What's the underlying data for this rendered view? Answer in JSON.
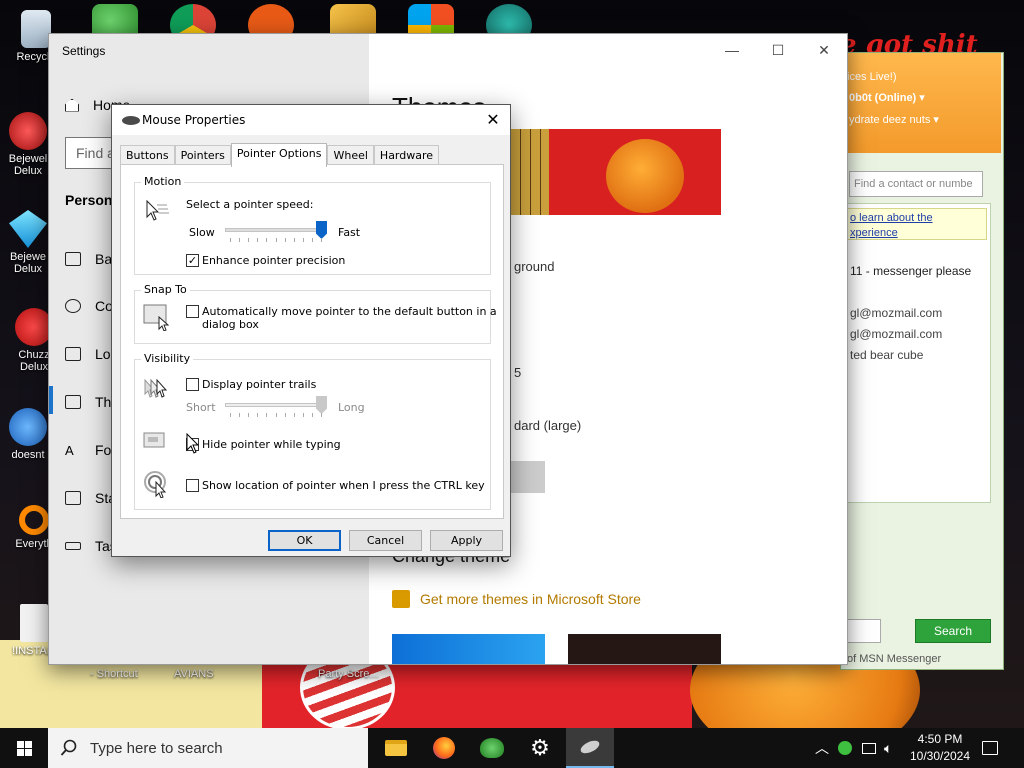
{
  "desktop": {
    "icons": [
      {
        "label": "Recycle",
        "name": "recycle-bin"
      },
      {
        "label": "Bejewel\nDelux",
        "name": "bejeweled-1"
      },
      {
        "label": "Bejewe\nDelux",
        "name": "bejeweled-2"
      },
      {
        "label": "Chuzz\nDelux",
        "name": "chuzzle"
      },
      {
        "label": "doesnt",
        "name": "doesnt"
      },
      {
        "label": "Everyth",
        "name": "everything"
      },
      {
        "label": "!INSTALI",
        "name": "install"
      }
    ],
    "shortcut_labels": [
      "- Shortcut",
      "AVIANS",
      "Party Scre..."
    ],
    "wallpaper_text": "e got shit"
  },
  "settings": {
    "title": "Settings",
    "controls": {
      "minimize": "—",
      "maximize": "☐",
      "close": "✕"
    },
    "home": "Home",
    "find_placeholder": "Find a",
    "section": "Personal",
    "nav": [
      {
        "label": "Ba",
        "name": "nav-background"
      },
      {
        "label": "Co",
        "name": "nav-colors"
      },
      {
        "label": "Lo",
        "name": "nav-lock-screen"
      },
      {
        "label": "Th",
        "name": "nav-themes"
      },
      {
        "label": "Fo",
        "name": "nav-fonts"
      },
      {
        "label": "Sta",
        "name": "nav-start"
      },
      {
        "label": "Tas",
        "name": "nav-taskbar"
      }
    ],
    "page_title": "Themes",
    "lines": [
      "ground",
      "5",
      "dard (large)"
    ],
    "change_theme": "Change theme",
    "store_link": "Get more themes in Microsoft Store"
  },
  "messenger": {
    "header": [
      "ices Live!)",
      "0b0t  (Online) ▾",
      "ydrate deez nuts ▾"
    ],
    "find_placeholder": "Find a contact or numbe",
    "note": [
      "o learn about the",
      "xperience"
    ],
    "items": [
      "11 - messenger please",
      "gl@mozmail.com",
      "gl@mozmail.com",
      "ted bear cube"
    ],
    "search_button": "Search",
    "footer": "of MSN Messenger"
  },
  "dialog": {
    "title": "Mouse Properties",
    "close": "✕",
    "tabs": [
      "Buttons",
      "Pointers",
      "Pointer Options",
      "Wheel",
      "Hardware"
    ],
    "active_tab": 2,
    "motion": {
      "label": "Motion",
      "speed_label": "Select a pointer speed:",
      "slow": "Slow",
      "fast": "Fast",
      "speed_value": 1.0,
      "enhance_label": "Enhance pointer precision",
      "enhance_checked": true
    },
    "snap": {
      "label": "Snap To",
      "text_1": "Automatically move pointer to the default button in a",
      "text_2": "dialog box",
      "checked": false
    },
    "visibility": {
      "label": "Visibility",
      "trails_label": "Display pointer trails",
      "trails_checked": false,
      "short": "Short",
      "long": "Long",
      "trail_value": 1.0,
      "hide_label": "Hide pointer while typing",
      "hide_checked": false,
      "ctrl_label": "Show location of pointer when I press the CTRL key",
      "ctrl_checked": false
    },
    "buttons": {
      "ok": "OK",
      "cancel": "Cancel",
      "apply": "Apply"
    }
  },
  "taskbar": {
    "search_placeholder": "Type here to search",
    "time": "4:50 PM",
    "date": "10/30/2024"
  },
  "colors": {
    "accent": "#0a64c8",
    "taskbar": "#101010",
    "msn_header": "#f39a2b",
    "store_link": "#b37a00"
  }
}
